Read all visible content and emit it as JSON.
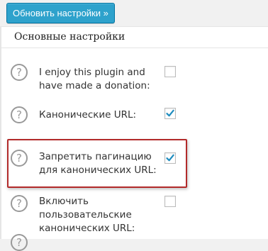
{
  "toolbar": {
    "update_label": "Обновить настройки »"
  },
  "panel": {
    "title": "Основные настройки"
  },
  "help_glyph": "?",
  "options": [
    {
      "line1": "I enjoy this plugin and",
      "line2": "have made a donation:",
      "checked": false
    },
    {
      "line1": "Канонические URL:",
      "checked": true
    },
    {
      "line1": "Запретить пагинацию",
      "line2": "для канонических URL:",
      "checked": true,
      "highlighted": true
    },
    {
      "line1": "Включить",
      "line2": "пользовательские",
      "line3": "канонических URL:",
      "checked": false
    }
  ],
  "colors": {
    "button": "#2ea2cc",
    "check": "#1e8cbe",
    "highlight_border": "#b22a2a"
  }
}
